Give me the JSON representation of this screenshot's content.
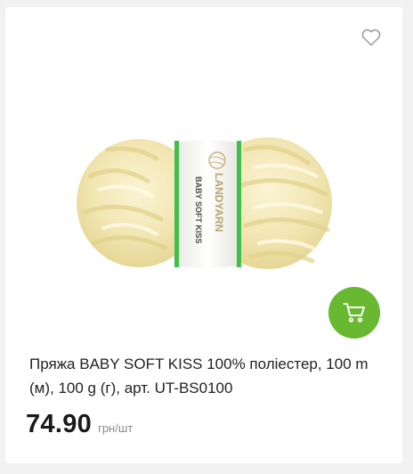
{
  "product": {
    "title": "Пряжа BABY SOFT KISS 100% поліестер, 100 m (м), 100 g (г), арт. UT-BS0100",
    "price": "74.90",
    "price_unit": "грн/шт",
    "label_brand": "LANDYARN",
    "label_product": "BABY SOFT KISS",
    "image_alt": "Yarn skein BABY SOFT KISS, cream color"
  },
  "icons": {
    "favorite": "heart-outline-icon",
    "cart": "cart-icon"
  },
  "colors": {
    "accent_green": "#69b832",
    "yarn": "#f3e8b8",
    "label_stripe": "#3fbf4a"
  }
}
